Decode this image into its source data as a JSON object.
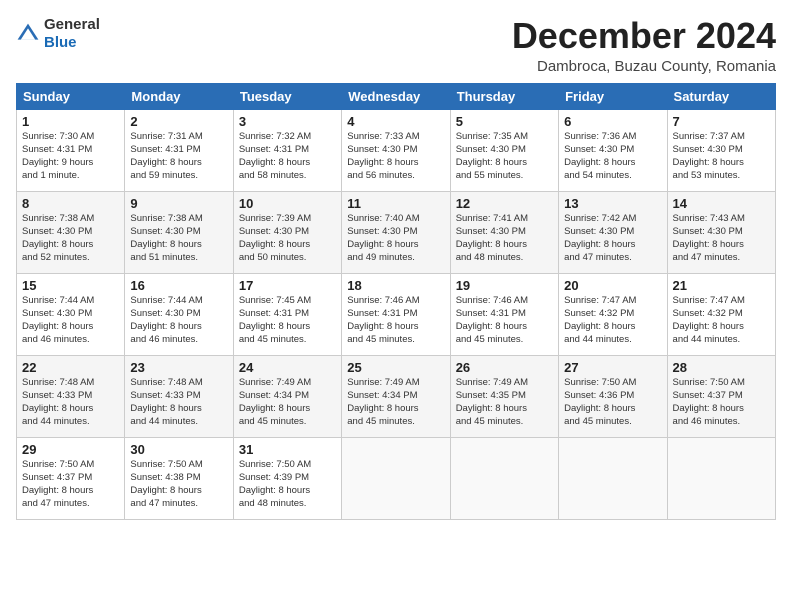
{
  "logo": {
    "text_general": "General",
    "text_blue": "Blue"
  },
  "header": {
    "month": "December 2024",
    "location": "Dambroca, Buzau County, Romania"
  },
  "weekdays": [
    "Sunday",
    "Monday",
    "Tuesday",
    "Wednesday",
    "Thursday",
    "Friday",
    "Saturday"
  ],
  "weeks": [
    [
      {
        "day": "1",
        "sunrise": "Sunrise: 7:30 AM",
        "sunset": "Sunset: 4:31 PM",
        "daylight": "Daylight: 9 hours and 1 minute."
      },
      {
        "day": "2",
        "sunrise": "Sunrise: 7:31 AM",
        "sunset": "Sunset: 4:31 PM",
        "daylight": "Daylight: 8 hours and 59 minutes."
      },
      {
        "day": "3",
        "sunrise": "Sunrise: 7:32 AM",
        "sunset": "Sunset: 4:31 PM",
        "daylight": "Daylight: 8 hours and 58 minutes."
      },
      {
        "day": "4",
        "sunrise": "Sunrise: 7:33 AM",
        "sunset": "Sunset: 4:30 PM",
        "daylight": "Daylight: 8 hours and 56 minutes."
      },
      {
        "day": "5",
        "sunrise": "Sunrise: 7:35 AM",
        "sunset": "Sunset: 4:30 PM",
        "daylight": "Daylight: 8 hours and 55 minutes."
      },
      {
        "day": "6",
        "sunrise": "Sunrise: 7:36 AM",
        "sunset": "Sunset: 4:30 PM",
        "daylight": "Daylight: 8 hours and 54 minutes."
      },
      {
        "day": "7",
        "sunrise": "Sunrise: 7:37 AM",
        "sunset": "Sunset: 4:30 PM",
        "daylight": "Daylight: 8 hours and 53 minutes."
      }
    ],
    [
      {
        "day": "8",
        "sunrise": "Sunrise: 7:38 AM",
        "sunset": "Sunset: 4:30 PM",
        "daylight": "Daylight: 8 hours and 52 minutes."
      },
      {
        "day": "9",
        "sunrise": "Sunrise: 7:38 AM",
        "sunset": "Sunset: 4:30 PM",
        "daylight": "Daylight: 8 hours and 51 minutes."
      },
      {
        "day": "10",
        "sunrise": "Sunrise: 7:39 AM",
        "sunset": "Sunset: 4:30 PM",
        "daylight": "Daylight: 8 hours and 50 minutes."
      },
      {
        "day": "11",
        "sunrise": "Sunrise: 7:40 AM",
        "sunset": "Sunset: 4:30 PM",
        "daylight": "Daylight: 8 hours and 49 minutes."
      },
      {
        "day": "12",
        "sunrise": "Sunrise: 7:41 AM",
        "sunset": "Sunset: 4:30 PM",
        "daylight": "Daylight: 8 hours and 48 minutes."
      },
      {
        "day": "13",
        "sunrise": "Sunrise: 7:42 AM",
        "sunset": "Sunset: 4:30 PM",
        "daylight": "Daylight: 8 hours and 47 minutes."
      },
      {
        "day": "14",
        "sunrise": "Sunrise: 7:43 AM",
        "sunset": "Sunset: 4:30 PM",
        "daylight": "Daylight: 8 hours and 47 minutes."
      }
    ],
    [
      {
        "day": "15",
        "sunrise": "Sunrise: 7:44 AM",
        "sunset": "Sunset: 4:30 PM",
        "daylight": "Daylight: 8 hours and 46 minutes."
      },
      {
        "day": "16",
        "sunrise": "Sunrise: 7:44 AM",
        "sunset": "Sunset: 4:30 PM",
        "daylight": "Daylight: 8 hours and 46 minutes."
      },
      {
        "day": "17",
        "sunrise": "Sunrise: 7:45 AM",
        "sunset": "Sunset: 4:31 PM",
        "daylight": "Daylight: 8 hours and 45 minutes."
      },
      {
        "day": "18",
        "sunrise": "Sunrise: 7:46 AM",
        "sunset": "Sunset: 4:31 PM",
        "daylight": "Daylight: 8 hours and 45 minutes."
      },
      {
        "day": "19",
        "sunrise": "Sunrise: 7:46 AM",
        "sunset": "Sunset: 4:31 PM",
        "daylight": "Daylight: 8 hours and 45 minutes."
      },
      {
        "day": "20",
        "sunrise": "Sunrise: 7:47 AM",
        "sunset": "Sunset: 4:32 PM",
        "daylight": "Daylight: 8 hours and 44 minutes."
      },
      {
        "day": "21",
        "sunrise": "Sunrise: 7:47 AM",
        "sunset": "Sunset: 4:32 PM",
        "daylight": "Daylight: 8 hours and 44 minutes."
      }
    ],
    [
      {
        "day": "22",
        "sunrise": "Sunrise: 7:48 AM",
        "sunset": "Sunset: 4:33 PM",
        "daylight": "Daylight: 8 hours and 44 minutes."
      },
      {
        "day": "23",
        "sunrise": "Sunrise: 7:48 AM",
        "sunset": "Sunset: 4:33 PM",
        "daylight": "Daylight: 8 hours and 44 minutes."
      },
      {
        "day": "24",
        "sunrise": "Sunrise: 7:49 AM",
        "sunset": "Sunset: 4:34 PM",
        "daylight": "Daylight: 8 hours and 45 minutes."
      },
      {
        "day": "25",
        "sunrise": "Sunrise: 7:49 AM",
        "sunset": "Sunset: 4:34 PM",
        "daylight": "Daylight: 8 hours and 45 minutes."
      },
      {
        "day": "26",
        "sunrise": "Sunrise: 7:49 AM",
        "sunset": "Sunset: 4:35 PM",
        "daylight": "Daylight: 8 hours and 45 minutes."
      },
      {
        "day": "27",
        "sunrise": "Sunrise: 7:50 AM",
        "sunset": "Sunset: 4:36 PM",
        "daylight": "Daylight: 8 hours and 45 minutes."
      },
      {
        "day": "28",
        "sunrise": "Sunrise: 7:50 AM",
        "sunset": "Sunset: 4:37 PM",
        "daylight": "Daylight: 8 hours and 46 minutes."
      }
    ],
    [
      {
        "day": "29",
        "sunrise": "Sunrise: 7:50 AM",
        "sunset": "Sunset: 4:37 PM",
        "daylight": "Daylight: 8 hours and 47 minutes."
      },
      {
        "day": "30",
        "sunrise": "Sunrise: 7:50 AM",
        "sunset": "Sunset: 4:38 PM",
        "daylight": "Daylight: 8 hours and 47 minutes."
      },
      {
        "day": "31",
        "sunrise": "Sunrise: 7:50 AM",
        "sunset": "Sunset: 4:39 PM",
        "daylight": "Daylight: 8 hours and 48 minutes."
      },
      null,
      null,
      null,
      null
    ]
  ]
}
